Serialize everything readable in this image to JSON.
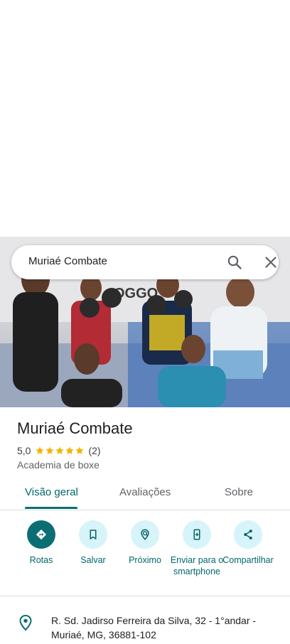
{
  "search": {
    "query": "Muriaé Combate",
    "search_icon": "search-icon",
    "close_icon": "close-icon"
  },
  "photo": {
    "description_icon": "place-photo"
  },
  "place": {
    "name": "Muriaé Combate",
    "rating": "5,0",
    "rating_value": 5,
    "stars_max": 5,
    "review_count": "(2)",
    "category": "Academia de boxe"
  },
  "tabs": [
    {
      "label": "Visão geral",
      "active": true
    },
    {
      "label": "Avaliações",
      "active": false
    },
    {
      "label": "Sobre",
      "active": false
    }
  ],
  "actions": [
    {
      "label": "Rotas",
      "icon": "directions-icon"
    },
    {
      "label": "Salvar",
      "icon": "bookmark-icon"
    },
    {
      "label": "Próximo",
      "icon": "nearby-icon"
    },
    {
      "label": "Enviar para o smartphone",
      "icon": "send-to-phone-icon"
    },
    {
      "label": "Compartilhar",
      "icon": "share-icon"
    }
  ],
  "address": {
    "text": "R. Sd. Jadirso Ferreira da Silva, 32 - 1°andar - Muriaé, MG, 36881-102",
    "icon": "location-pin-icon"
  },
  "colors": {
    "accent": "#0b6e73",
    "accent_text": "#00676b",
    "action_bg": "#d6f4f9",
    "star": "#f4b400"
  }
}
